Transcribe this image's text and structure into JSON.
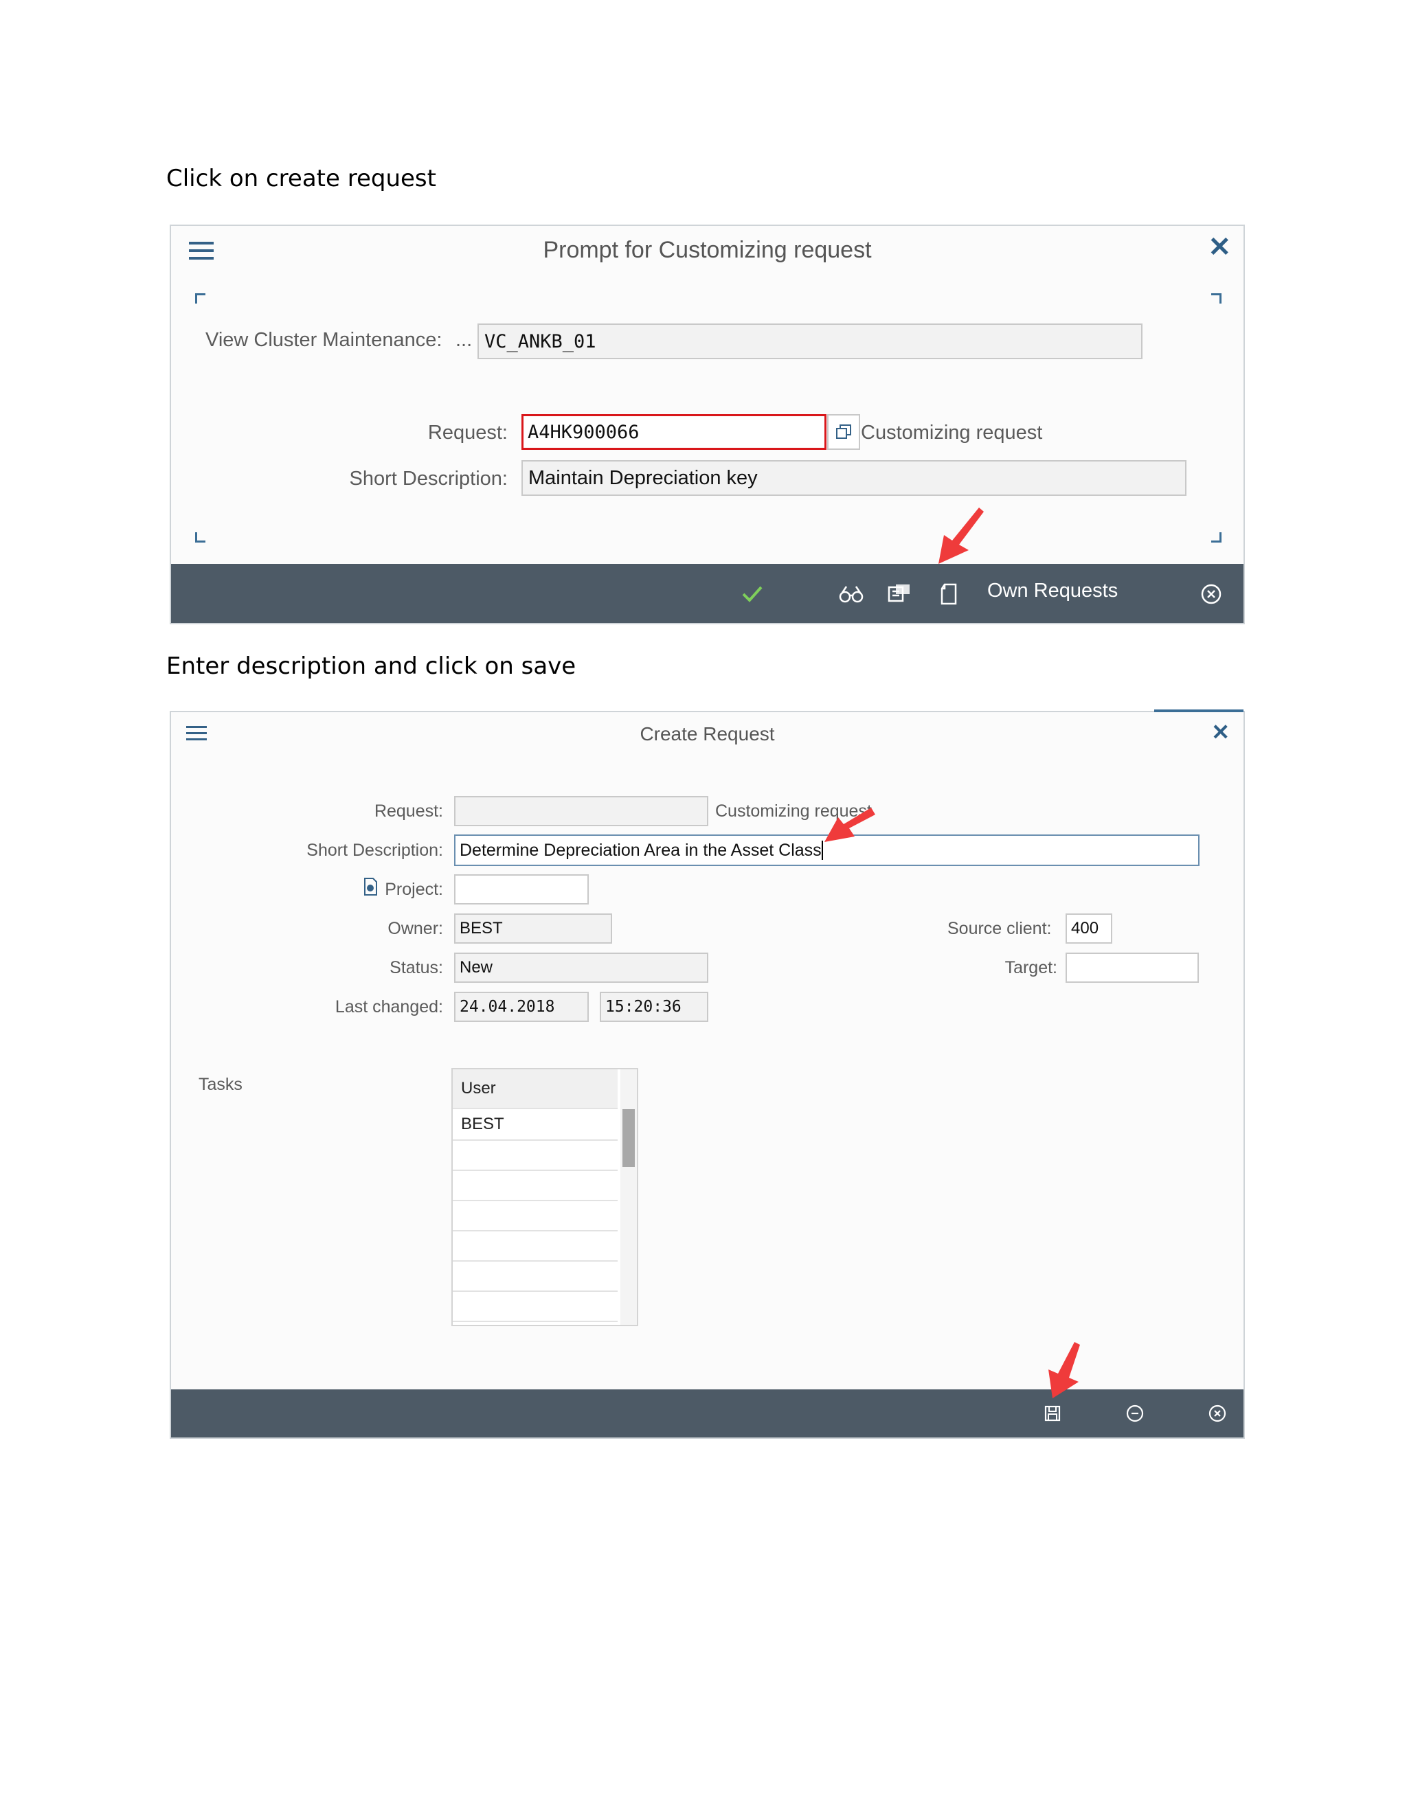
{
  "step1": {
    "caption": "Click on create request",
    "dialog_title": "Prompt for Customizing request",
    "view_cluster_label": "View Cluster Maintenance:",
    "ellipsis": "...",
    "view_cluster_value": "VC_ANKB_01",
    "request_label": "Request:",
    "request_value": "A4HK900066",
    "request_type": "Customizing request",
    "short_desc_label": "Short Description:",
    "short_desc_value": "Maintain Depreciation key",
    "footer": {
      "own_requests_label": "Own Requests",
      "icons": [
        "check-icon",
        "binoculars-icon",
        "display-object-icon",
        "create-request-icon",
        "cancel-icon"
      ]
    }
  },
  "step2": {
    "caption": "Enter description and click on save",
    "dialog_title": "Create Request",
    "request_label": "Request:",
    "request_value": "",
    "request_type": "Customizing request",
    "short_desc_label": "Short Description:",
    "short_desc_value": "Determine Depreciation Area in the Asset Class",
    "project_label": "Project:",
    "project_value": "",
    "owner_label": "Owner:",
    "owner_value": "BEST",
    "status_label": "Status:",
    "status_value": "New",
    "last_changed_label": "Last changed:",
    "last_changed_date": "24.04.2018",
    "last_changed_time": "15:20:36",
    "source_client_label": "Source client:",
    "source_client_value": "400",
    "target_label": "Target:",
    "target_value": "",
    "tasks_label": "Tasks",
    "tasks_table": {
      "header": "User",
      "rows": [
        "BEST",
        "",
        "",
        "",
        "",
        "",
        ""
      ]
    },
    "footer": {
      "icons": [
        "save-icon",
        "minus-circle-icon",
        "cancel-icon"
      ]
    }
  },
  "colors": {
    "footer_bg": "#4d5a66",
    "highlight_border": "#d9171b",
    "arrow": "#ef3b3b",
    "accent": "#346187"
  }
}
